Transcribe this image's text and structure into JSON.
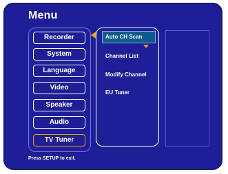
{
  "menu": {
    "title": "Menu"
  },
  "left_menu": {
    "items": [
      {
        "label": "Recorder"
      },
      {
        "label": "System"
      },
      {
        "label": "Language"
      },
      {
        "label": "Video"
      },
      {
        "label": "Speaker"
      },
      {
        "label": "Audio"
      },
      {
        "label": "TV Tuner"
      }
    ],
    "active_index": 6
  },
  "submenu": {
    "items": [
      {
        "label": "Auto CH Scan"
      },
      {
        "label": "Channel List"
      },
      {
        "label": "Modify Channel"
      },
      {
        "label": "EU Tuner"
      }
    ],
    "selected_index": 0
  },
  "footer": {
    "hint": "Press SETUP to exit."
  },
  "colors": {
    "background": "#1e1e96",
    "highlight_border": "#f0a020",
    "selected_fill": "#0e5a8c",
    "text": "#ffffff"
  },
  "icons": {
    "selection_left": "triangle-left-icon",
    "more_down": "triangle-down-icon"
  }
}
